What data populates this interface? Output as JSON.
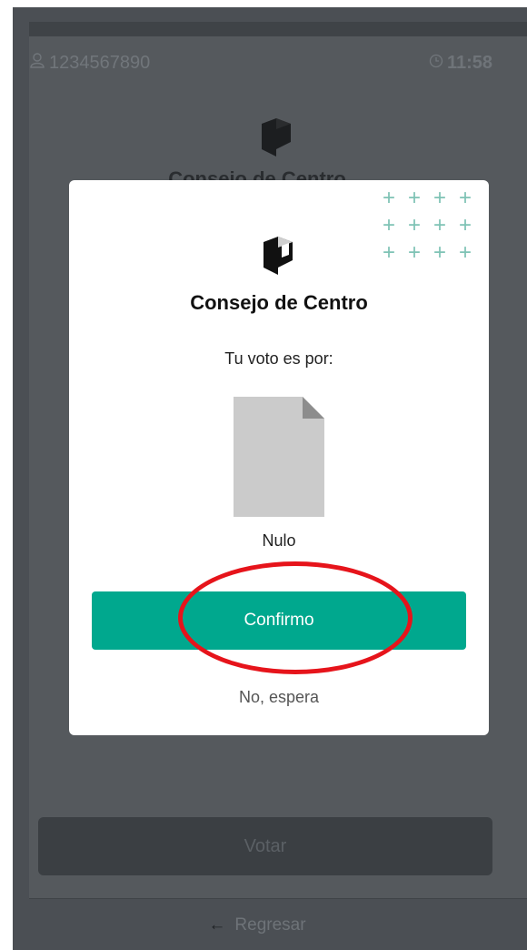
{
  "status": {
    "user_id": "1234567890",
    "time": "11:58"
  },
  "background": {
    "title": "Consejo de Centro",
    "vote_button": "Votar",
    "back_link": "Regresar"
  },
  "modal": {
    "title": "Consejo de Centro",
    "subtitle": "Tu voto es por:",
    "choice": "Nulo",
    "confirm_label": "Confirmo",
    "cancel_label": "No, espera"
  },
  "icons": {
    "user": "user-icon",
    "clock": "clock-icon",
    "logo": "logo-icon",
    "document": "document-icon",
    "back": "arrow-left-icon",
    "decoration": "plus-pattern-icon"
  },
  "colors": {
    "accent": "#00a88e",
    "overlay": "#4b4f54",
    "annotation": "#e6141b"
  }
}
